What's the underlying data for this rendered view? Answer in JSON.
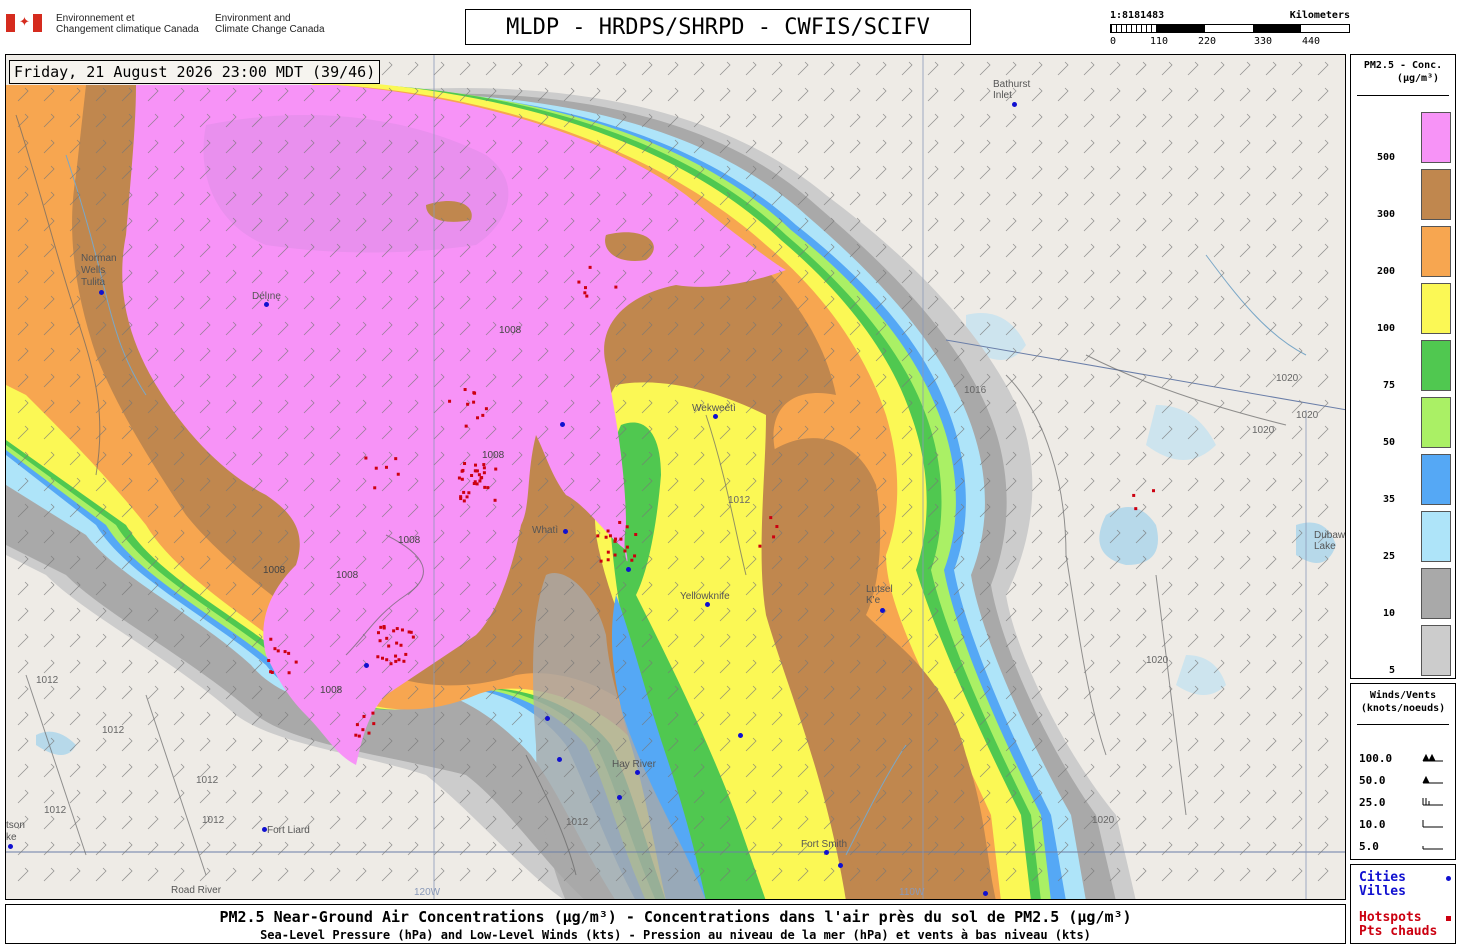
{
  "header": {
    "dept_fr": [
      "Environnement et",
      "Changement climatique Canada"
    ],
    "dept_en": [
      "Environment and",
      "Climate Change Canada"
    ],
    "title": "MLDP - HRDPS/SHRPD - CWFIS/SCIFV"
  },
  "scale": {
    "ratio": "1:8181483",
    "unit": "Kilometers",
    "ticks": [
      "0",
      "110",
      "220",
      "330",
      "440"
    ]
  },
  "map": {
    "datetime": "Friday, 21 August 2026 23:00 MDT (39/46)",
    "places": [
      {
        "name": "Bathurst Inlet",
        "lines": [
          "Bathurst",
          "Inlet"
        ],
        "dot": true
      },
      {
        "name": "Norman Wells / Tulita",
        "lines": [
          "Norman",
          "Wells",
          "Tulita"
        ],
        "dot": true
      },
      {
        "name": "Délı̨nę",
        "lines": [
          "Délı̨nę"
        ],
        "dot": true
      },
      {
        "name": "Wekweètì",
        "lines": [
          "Wekweètì"
        ],
        "dot": true
      },
      {
        "name": "Whatì",
        "lines": [
          "Whatì"
        ],
        "dot": true
      },
      {
        "name": "Yellowknife",
        "lines": [
          "Yellowknife"
        ],
        "dot": true
      },
      {
        "name": "Lutsel K'e",
        "lines": [
          "Lutsel",
          "K'e"
        ],
        "dot": true
      },
      {
        "name": "Hay River",
        "lines": [
          "Hay River"
        ],
        "dot": true
      },
      {
        "name": "Fort Liard",
        "lines": [
          "Fort Liard"
        ],
        "dot": true
      },
      {
        "name": "Fort Smith",
        "lines": [
          "Fort Smith"
        ],
        "dot": true
      },
      {
        "name": "Road River",
        "lines": [
          "Road River"
        ],
        "dot": false
      },
      {
        "name": "Dubawnt Lake",
        "lines": [
          "Dubawnt",
          "Lake"
        ],
        "dot": false
      },
      {
        "name": "Watson",
        "lines": [
          "tson",
          "ke"
        ],
        "dot": true
      }
    ],
    "longitude_labels": [
      "120W",
      "110W"
    ],
    "isobar_labels": [
      "1008",
      "1008",
      "1008",
      "1008",
      "1008",
      "1008",
      "1012",
      "1012",
      "1012",
      "1012",
      "1012",
      "1012",
      "1012",
      "1016",
      "1020",
      "1020",
      "1020",
      "1020",
      "1020"
    ]
  },
  "legend_concentration": {
    "title": [
      "PM2.5 - Conc.",
      "(µg/m³)"
    ],
    "levels": [
      {
        "label": "500",
        "color": "#f793f7"
      },
      {
        "label": "300",
        "color": "#c0874e"
      },
      {
        "label": "200",
        "color": "#f7a650"
      },
      {
        "label": "100",
        "color": "#fbf855"
      },
      {
        "label": "75",
        "color": "#50c850"
      },
      {
        "label": "50",
        "color": "#aaf065"
      },
      {
        "label": "35",
        "color": "#55a8f5"
      },
      {
        "label": "25",
        "color": "#aee4f9"
      },
      {
        "label": "10",
        "color": "#a9a9a9"
      },
      {
        "label": "5",
        "color": "#cccccc"
      }
    ]
  },
  "legend_winds": {
    "title": [
      "Winds/Vents",
      "(knots/noeuds)"
    ],
    "rows": [
      "100.0",
      "50.0",
      "25.0",
      "10.0",
      "5.0"
    ]
  },
  "legend_places": {
    "cities": [
      "Cities",
      "Villes"
    ],
    "hotspots": [
      "Hotspots",
      "Pts chauds"
    ],
    "city_color": "#1010d0",
    "hotspot_color": "#cc0010"
  },
  "footer": {
    "line1": "PM2.5 Near-Ground Air Concentrations (µg/m³) - Concentrations dans l'air près du sol de PM2.5 (µg/m³)",
    "line2": "Sea-Level Pressure (hPa) and Low-Level Winds (kts) - Pression au niveau de la mer (hPa) et vents à bas niveau (kts)"
  }
}
